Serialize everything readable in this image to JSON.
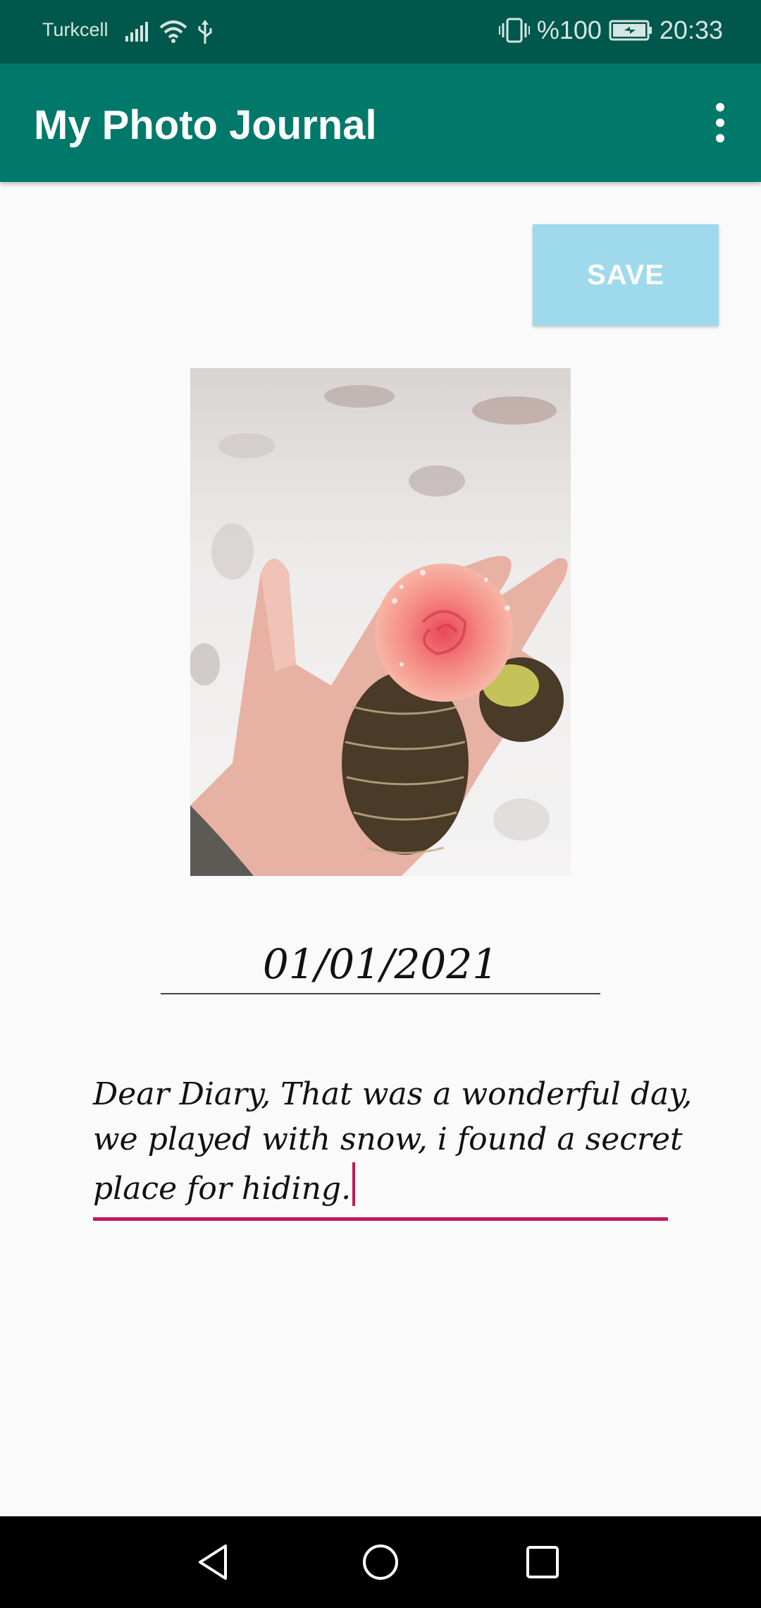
{
  "status_bar": {
    "carrier": "Turkcell",
    "battery": "%100",
    "time": "20:33",
    "icons": [
      "signal-icon",
      "wifi-icon",
      "usb-icon",
      "vibrate-icon",
      "battery-charging-icon"
    ]
  },
  "app_bar": {
    "title": "My Photo Journal",
    "menu_icon": "more-vertical-icon"
  },
  "toolbar": {
    "save_label": "SAVE"
  },
  "entry": {
    "date": "01/01/2021",
    "note_lines": [
      "Dear Diary, That was a wonderful day,",
      "we played with snow, i found a secret",
      "place for hiding."
    ]
  },
  "nav_bar": {
    "icons": [
      "back-icon",
      "home-icon",
      "recents-icon"
    ]
  },
  "colors": {
    "status_bar": "#00574b",
    "app_bar": "#00796b",
    "save_button": "#9fd9ec",
    "accent": "#c2185b"
  }
}
